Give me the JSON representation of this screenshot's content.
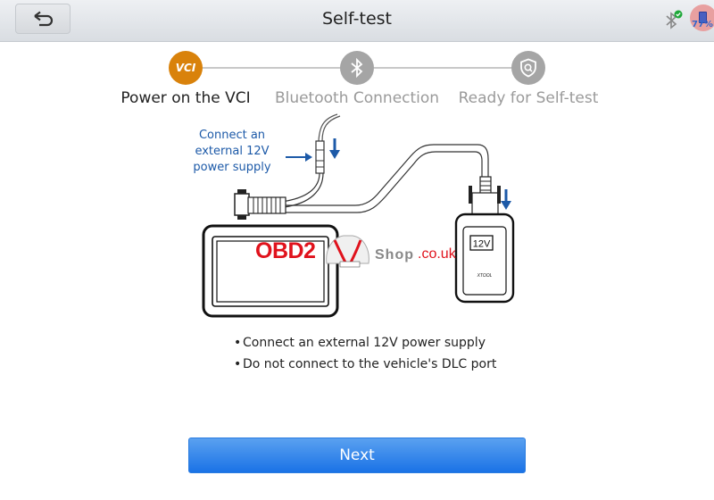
{
  "header": {
    "title": "Self-test",
    "back_icon": "back-arrow-icon",
    "bluetooth_status": "connected",
    "battery_level": "77%"
  },
  "steps": [
    {
      "label": "Power on the VCI",
      "icon_text": "VCI",
      "icon": "vci-icon",
      "state": "active"
    },
    {
      "label": "Bluetooth Connection",
      "icon": "bluetooth-icon",
      "state": "inactive"
    },
    {
      "label": "Ready for Self-test",
      "icon": "shield-search-icon",
      "state": "inactive"
    }
  ],
  "diagram": {
    "callout": [
      "Connect an",
      "external 12V",
      "power supply"
    ],
    "vci_label": "12V",
    "vci_brand": "XTOOL",
    "watermark": {
      "brand": "OBD2",
      "badge": "OBD2",
      "shop": "Shop",
      "domain": ".co.uk"
    }
  },
  "instructions": [
    "Connect an external 12V power supply",
    "Do not connect to the vehicle's DLC port"
  ],
  "actions": {
    "next_label": "Next"
  },
  "colors": {
    "active_step": "#d9820b",
    "inactive_step": "#a5a5a5",
    "primary_button": "#1a72e6",
    "callout_text": "#1d5aa8"
  }
}
